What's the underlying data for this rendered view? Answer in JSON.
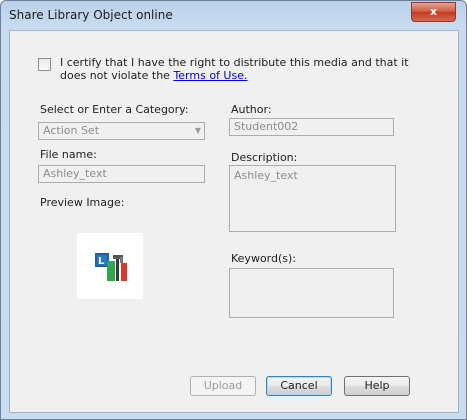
{
  "window": {
    "title": "Share Library Object online",
    "close_glyph": "x"
  },
  "certify": {
    "text": "I certify that I have the right to distribute this media and that it does not violate the ",
    "link": "Terms of Use."
  },
  "category": {
    "label": "Select or Enter a Category:",
    "value": "Action Set"
  },
  "author": {
    "label": "Author:",
    "value": "Student002"
  },
  "file_name": {
    "label": "File name:",
    "value": "Ashley_text"
  },
  "description": {
    "label": "Description:",
    "value": "Ashley_text"
  },
  "preview": {
    "label": "Preview Image:",
    "icon": "action-set-icon"
  },
  "keywords": {
    "label": "Keyword(s):",
    "value": ""
  },
  "buttons": {
    "upload": "Upload",
    "cancel": "Cancel",
    "help": "Help"
  },
  "colors": {
    "link": "#0000ee",
    "title_bar": "#b9d1ea",
    "close": "#c13a20"
  }
}
